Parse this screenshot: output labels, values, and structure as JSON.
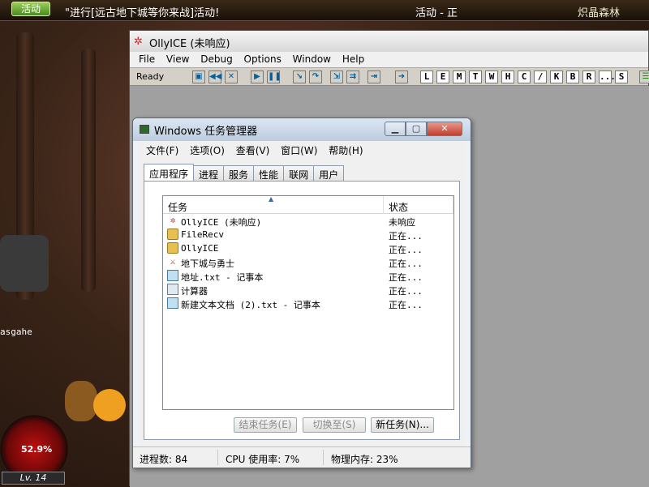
{
  "game": {
    "event_button": "活动",
    "event_text": "\"进行[远古地下城等你来战]活动!",
    "event_right": "活动 - 正",
    "location": "炽晶森林",
    "hp_percent": "52.9%",
    "level": "Lv. 14",
    "player_name": "asgahe"
  },
  "olly": {
    "title": "OllyICE (未响应)",
    "menu": [
      "File",
      "View",
      "Debug",
      "Options",
      "Window",
      "Help"
    ],
    "status": "Ready",
    "toolbar_letters": [
      "L",
      "E",
      "M",
      "T",
      "W",
      "H",
      "C",
      "/",
      "K",
      "B",
      "R",
      "...",
      "S"
    ]
  },
  "taskmgr": {
    "title": "Windows 任务管理器",
    "menu": [
      "文件(F)",
      "选项(O)",
      "查看(V)",
      "窗口(W)",
      "帮助(H)"
    ],
    "tabs": [
      "应用程序",
      "进程",
      "服务",
      "性能",
      "联网",
      "用户"
    ],
    "columns": {
      "task": "任务",
      "status": "状态"
    },
    "rows": [
      {
        "name": "OllyICE (未响应)",
        "status": "未响应",
        "icon": "olly-icon"
      },
      {
        "name": "FileRecv",
        "status": "正在...",
        "icon": "folder-icon"
      },
      {
        "name": "OllyICE",
        "status": "正在...",
        "icon": "folder-icon"
      },
      {
        "name": "地下城与勇士",
        "status": "正在...",
        "icon": "game-icon"
      },
      {
        "name": "地址.txt - 记事本",
        "status": "正在...",
        "icon": "notepad-icon"
      },
      {
        "name": "计算器",
        "status": "正在...",
        "icon": "calculator-icon"
      },
      {
        "name": "新建文本文档 (2).txt - 记事本",
        "status": "正在...",
        "icon": "notepad-icon"
      }
    ],
    "buttons": {
      "end_task": "结束任务(E)",
      "switch_to": "切换至(S)",
      "new_task": "新任务(N)..."
    },
    "statusbar": {
      "processes": "进程数: 84",
      "cpu": "CPU 使用率: 7%",
      "memory": "物理内存: 23%"
    }
  }
}
